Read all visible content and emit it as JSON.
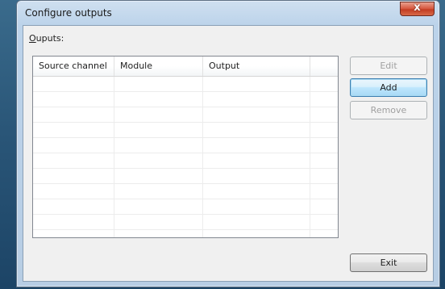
{
  "window": {
    "title": "Configure outputs",
    "close_glyph": "x"
  },
  "outputs_label": {
    "mnemonic": "O",
    "rest": "uputs:"
  },
  "list": {
    "columns": [
      "Source channel",
      "Module",
      "Output",
      ""
    ],
    "rows": []
  },
  "buttons": {
    "edit": "Edit",
    "add": "Add",
    "remove": "Remove",
    "exit": "Exit"
  },
  "colors": {
    "close_button": "#d5553c",
    "default_button_border": "#3c7fb1",
    "disabled_text": "#a0a0a0"
  }
}
